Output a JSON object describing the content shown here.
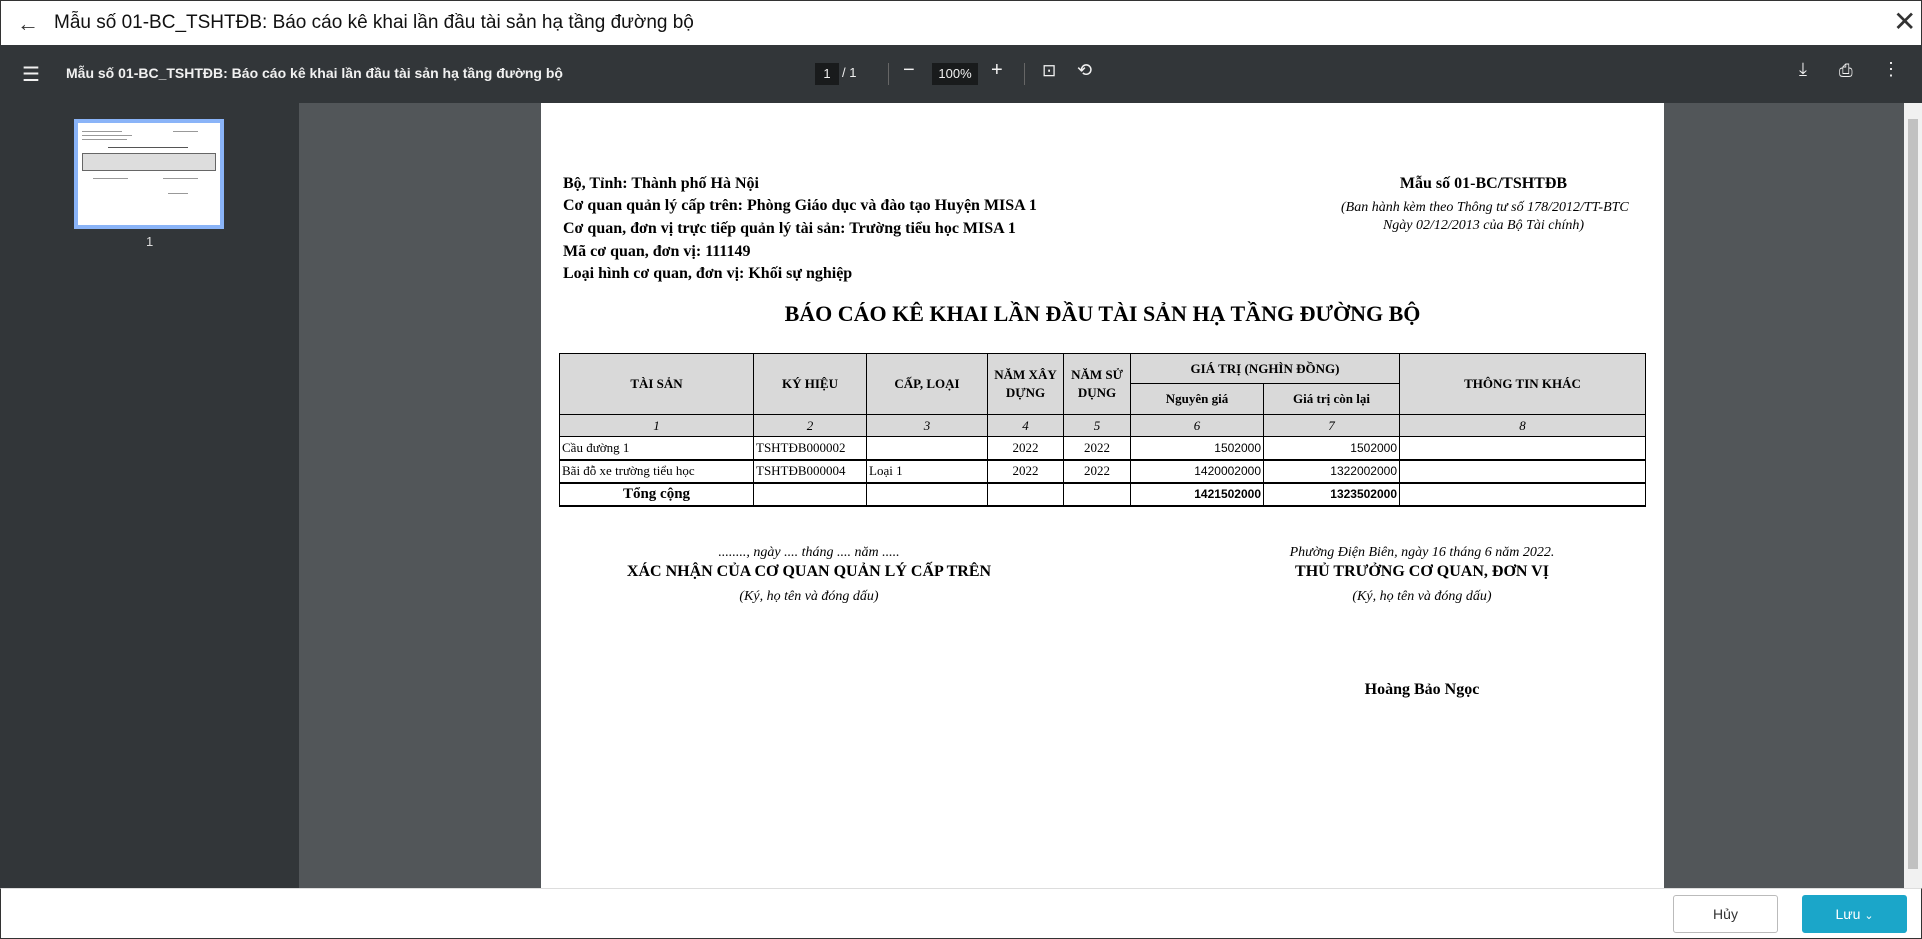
{
  "window": {
    "title": "Mẫu số 01-BC_TSHTĐB: Báo cáo kê khai lần đầu tài sản hạ tầng đường bộ"
  },
  "toolbar": {
    "title": "Mẫu số 01-BC_TSHTĐB: Báo cáo kê khai lần đầu tài sản hạ tầng đường bộ",
    "page_current": "1",
    "page_total": "1",
    "zoom": "100%"
  },
  "sidebar": {
    "thumb_label": "1"
  },
  "doc": {
    "info": [
      "Bộ, Tỉnh: Thành phố Hà Nội",
      "Cơ quan quản lý cấp trên: Phòng Giáo dục và đào tạo Huyện MISA 1",
      "Cơ quan, đơn vị trực tiếp quản lý tài sản: Trường tiểu học MISA 1",
      "Mã cơ quan, đơn vị: 111149",
      "Loại hình cơ quan, đơn vị: Khối sự nghiệp"
    ],
    "form_no": "Mẫu số 01-BC/TSHTĐB",
    "form_note1": "(Ban hành kèm theo Thông tư số 178/2012/TT-BTC",
    "form_note2": "Ngày 02/12/2013 của Bộ Tài chính)",
    "title": "BÁO CÁO KÊ KHAI LẦN ĐẦU TÀI SẢN HẠ TẦNG ĐƯỜNG BỘ",
    "table": {
      "headers": [
        "TÀI SẢN",
        "KÝ HIỆU",
        "CẤP, LOẠI",
        "NĂM XÂY DỰNG",
        "NĂM SỬ DỤNG",
        "GIÁ TRỊ (NGHÌN ĐỒNG)",
        "Nguyên giá",
        "Giá trị còn lại",
        "THÔNG TIN KHÁC"
      ],
      "numbers": [
        "1",
        "2",
        "3",
        "4",
        "5",
        "6",
        "7",
        "8"
      ],
      "rows": [
        [
          "Cầu đường 1",
          "TSHTĐB000002",
          "",
          "2022",
          "2022",
          "1502000",
          "1502000",
          ""
        ],
        [
          "Bãi đỗ xe trường tiểu học",
          "TSHTĐB000004",
          "Loại 1",
          "2022",
          "2022",
          "1420002000",
          "1322002000",
          ""
        ]
      ],
      "total": {
        "label": "Tổng cộng",
        "original": "1421502000",
        "remaining": "1323502000"
      }
    },
    "sig_left": {
      "date": "........, ngày .... tháng .... năm .....",
      "title": "XÁC NHẬN CỦA CƠ QUAN QUẢN LÝ CẤP TRÊN",
      "note": "(Ký, họ tên và đóng dấu)"
    },
    "sig_right": {
      "date": "Phường Điện Biên, ngày 16 tháng 6 năm 2022.",
      "title": "THỦ TRƯỞNG CƠ QUAN, ĐƠN VỊ",
      "note": "(Ký, họ tên và đóng dấu)",
      "name": "Hoàng Bảo Ngọc"
    }
  },
  "footer": {
    "cancel": "Hủy",
    "save": "Lưu"
  },
  "colors": {
    "accent": "#1ba6c9",
    "toolbar": "#323639",
    "viewer": "#525659"
  }
}
